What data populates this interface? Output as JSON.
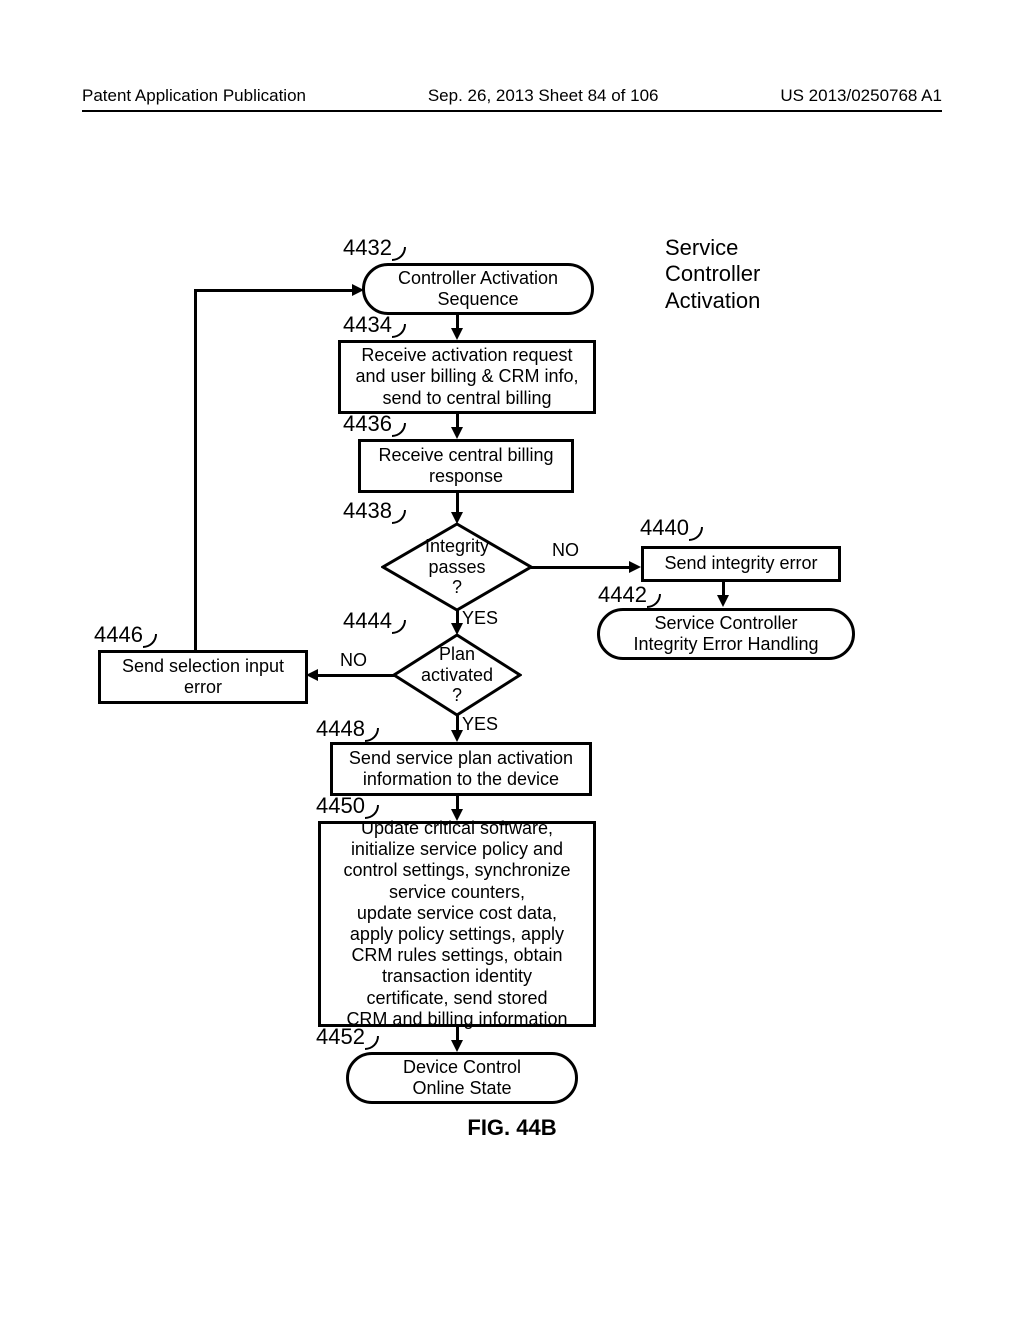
{
  "header": {
    "left": "Patent Application Publication",
    "mid": "Sep. 26, 2013  Sheet 84 of 106",
    "right": "US 2013/0250768 A1"
  },
  "title_right": "Service\nController\nActivation",
  "fig_label": "FIG. 44B",
  "refs": {
    "r4432": "4432",
    "r4434": "4434",
    "r4436": "4436",
    "r4438": "4438",
    "r4440": "4440",
    "r4442": "4442",
    "r4444": "4444",
    "r4446": "4446",
    "r4448": "4448",
    "r4450": "4450",
    "r4452": "4452"
  },
  "nodes": {
    "n4432": "Controller Activation\nSequence",
    "n4434": "Receive activation request\nand user billing & CRM info,\nsend to central billing",
    "n4436": "Receive central billing\nresponse",
    "n4438": "Integrity\npasses\n?",
    "n4440": "Send integrity error",
    "n4442": "Service Controller\nIntegrity Error Handling",
    "n4444": "Plan\nactivated\n?",
    "n4446": "Send selection input\nerror",
    "n4448": "Send service plan activation\ninformation to the device",
    "n4450": "Update critical software,\ninitialize service policy and\ncontrol settings, synchronize\nservice counters,\nupdate service cost data,\napply policy settings, apply\nCRM rules settings, obtain\ntransaction identity\ncertificate, send stored\nCRM and billing information",
    "n4452": "Device Control\nOnline State"
  },
  "labels": {
    "yes": "YES",
    "no": "NO"
  }
}
